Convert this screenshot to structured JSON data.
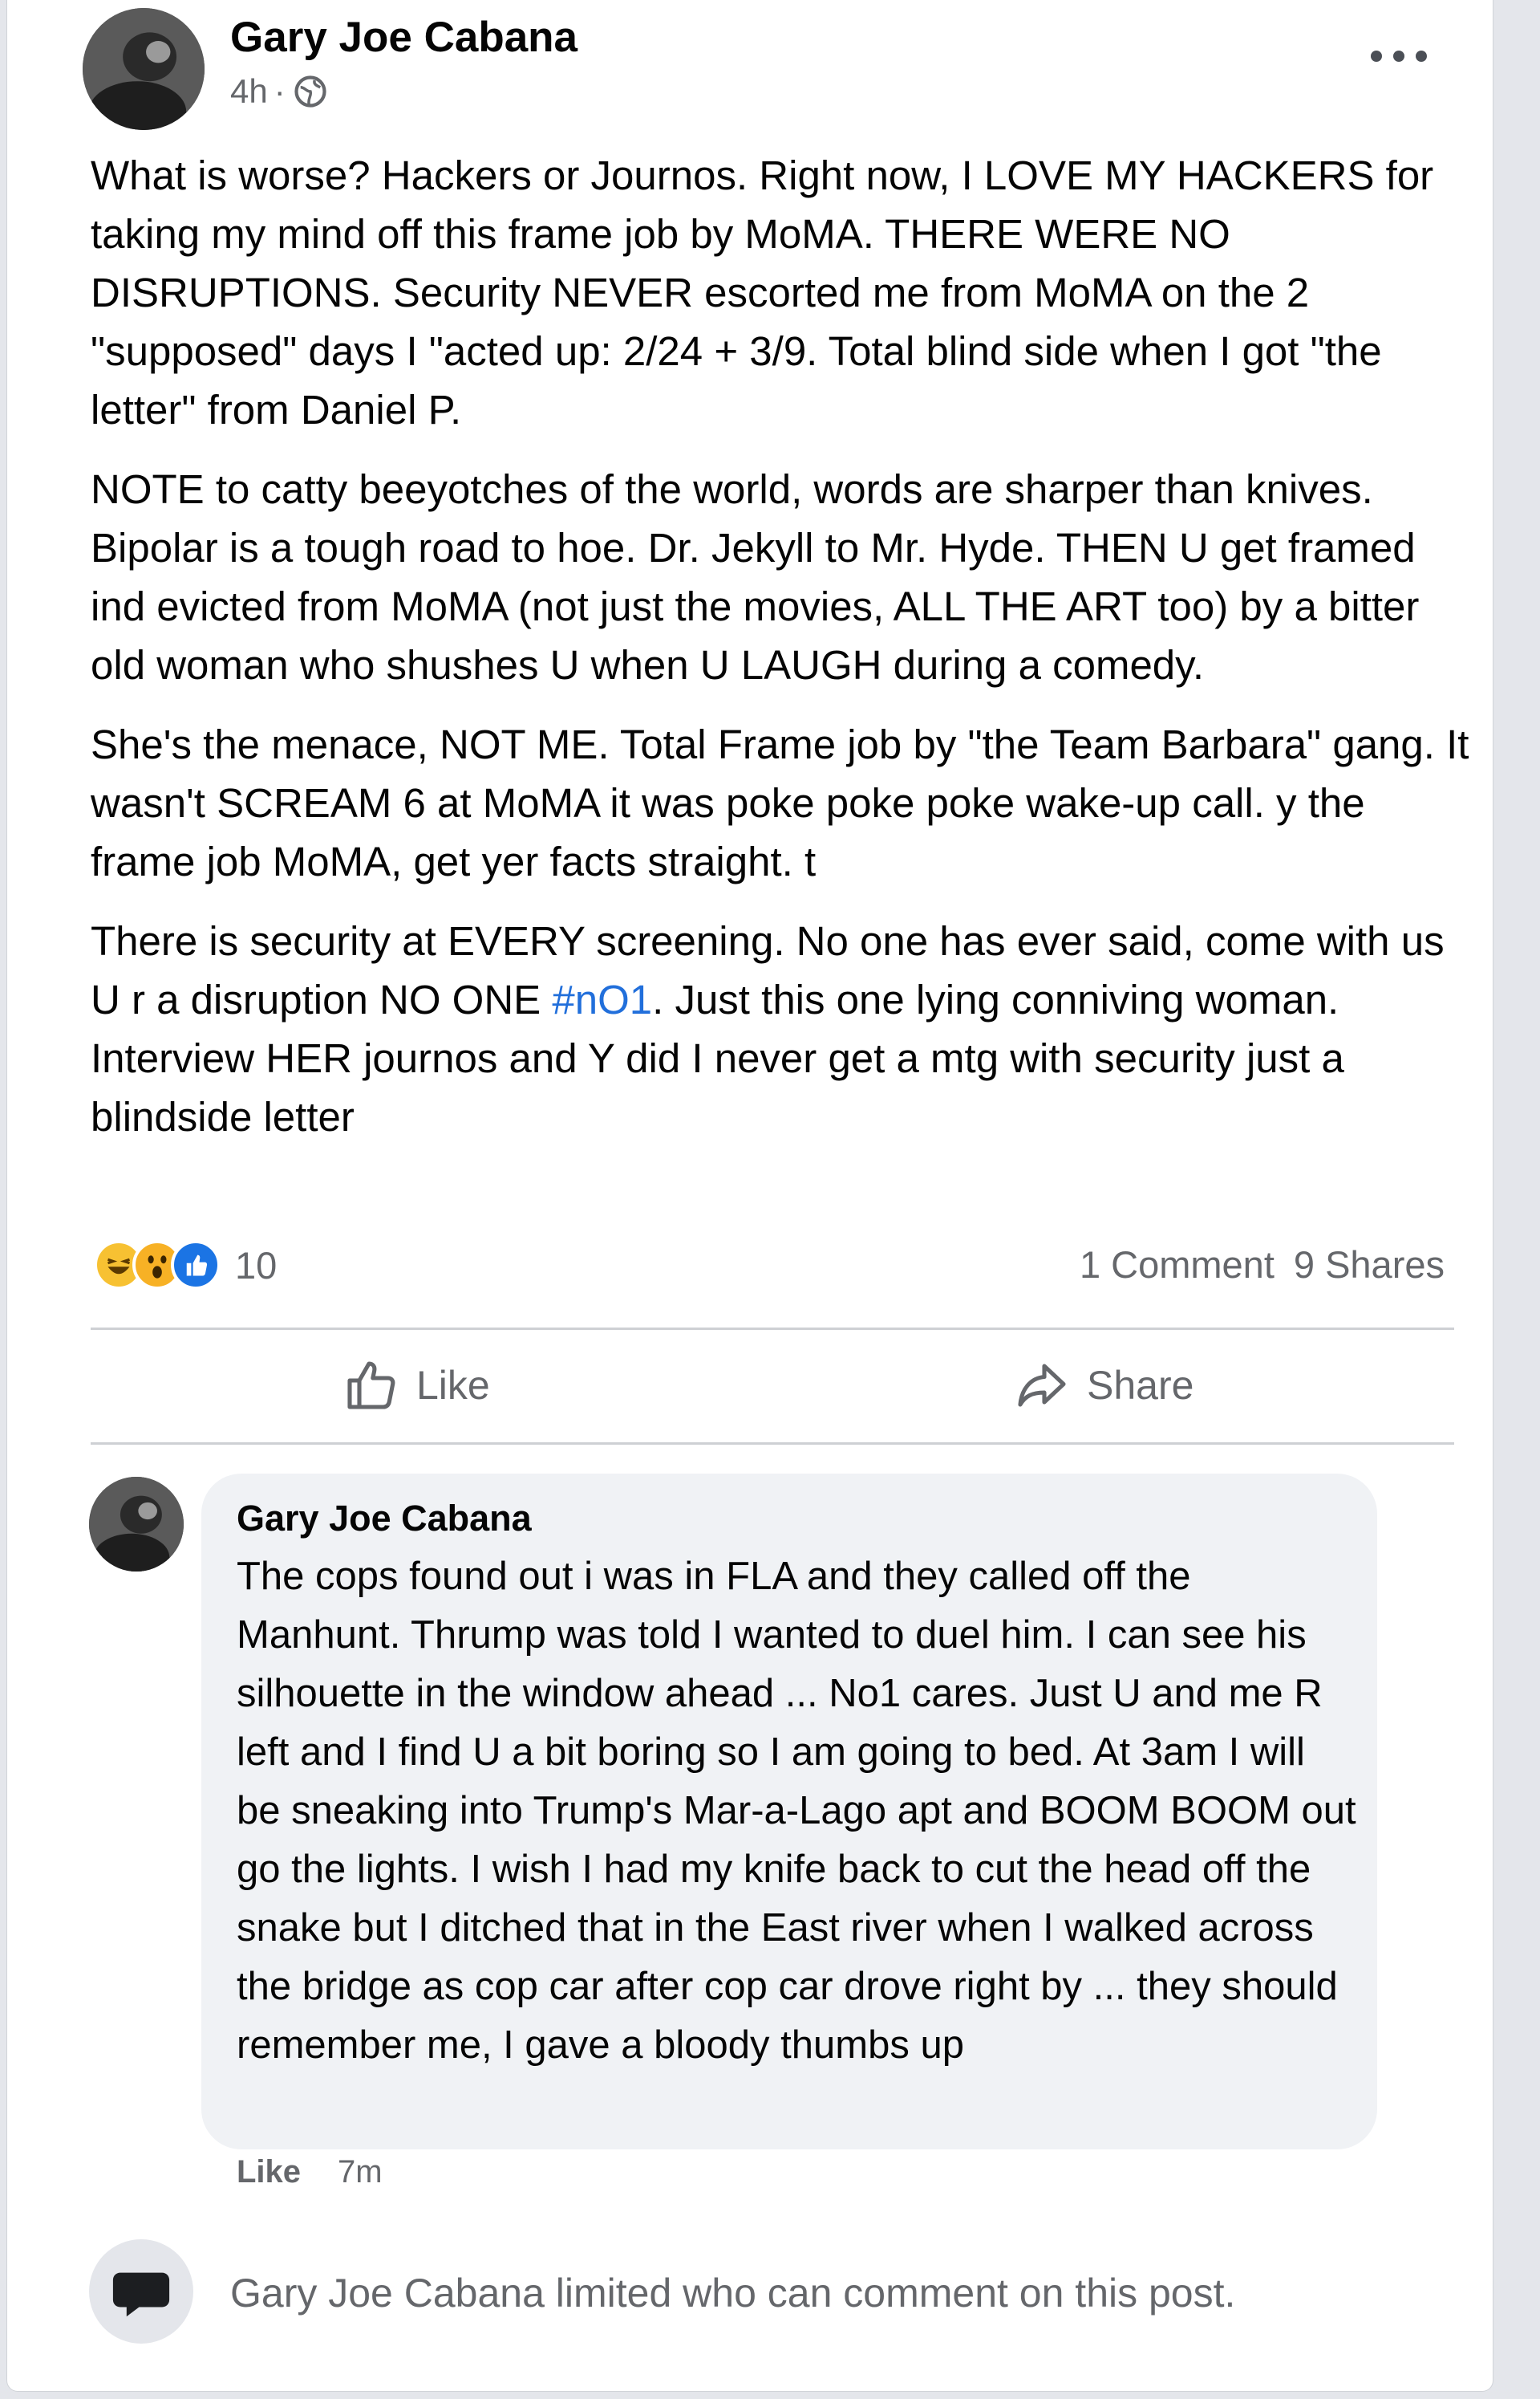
{
  "post": {
    "author": "Gary Joe Cabana",
    "time": "4h",
    "separator": "·",
    "paragraphs": [
      "What is worse? Hackers or Journos. Right now, I LOVE MY HACKERS for taking my mind off this frame job by MoMA. THERE WERE NO DISRUPTIONS. Security NEVER escorted me from MoMA on the 2 \"supposed\" days I \"acted up: 2/24 + 3/9. Total blind side when I got \"the letter\" from Daniel P.",
      "NOTE to catty beeyotches of the world, words are sharper than knives. Bipolar is a tough road to hoe. Dr. Jekyll to Mr. Hyde. THEN U get framed ind evicted from MoMA (not just the movies, ALL THE ART too) by a bitter old woman who shushes U when U LAUGH during a comedy.",
      "She's the menace, NOT ME. Total Frame job by \"the Team Barbara\" gang. It wasn't SCREAM 6 at MoMA it was poke poke poke wake-up call. y the frame job MoMA, get yer facts straight. t"
    ],
    "paragraph4_before": "There is security at EVERY screening. No one has ever said, come with us U r a disruption NO ONE ",
    "paragraph4_hashtag": "#nO1",
    "paragraph4_after": ". Just this one lying conniving woman. Interview HER journos and Y did I never get a mtg with security just a blindside letter"
  },
  "reactions": {
    "icons": [
      "haha-icon",
      "wow-icon",
      "like-icon"
    ],
    "count": "10",
    "comments": "1 Comment",
    "shares": "9 Shares"
  },
  "actions": {
    "like_label": "Like",
    "share_label": "Share"
  },
  "comment": {
    "author": "Gary Joe Cabana",
    "text": "The cops found out i was in FLA and they called off the Manhunt. Thrump was told I wanted to duel him. I can see his silhouette in the window ahead ... No1 cares. Just U and me R left and I find U a bit boring so I am going to bed. At 3am I will be sneaking into Trump's Mar-a-Lago apt and BOOM BOOM out go the lights. I wish I had my knife back to cut the head off the snake but I ditched that in the East river when I walked across the bridge as cop car after cop car drove right by ... they should remember me, I gave a bloody thumbs up",
    "like_label": "Like",
    "time": "7m"
  },
  "limited_notice": "Gary Joe Cabana limited who can comment on this post.",
  "colors": {
    "link": "#216fdb",
    "secondary_text": "#65676b",
    "bubble": "#f0f2f5"
  }
}
